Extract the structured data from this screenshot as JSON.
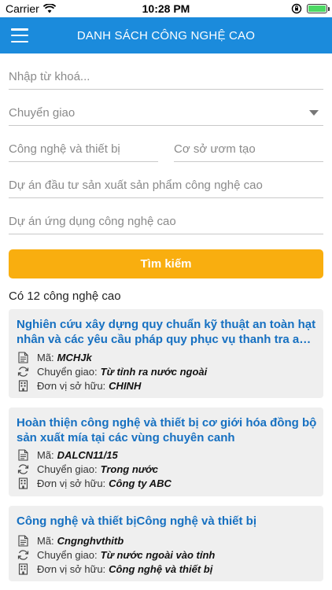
{
  "status_bar": {
    "carrier": "Carrier",
    "time": "10:28 PM"
  },
  "header": {
    "title": "DANH SÁCH CÔNG NGHỆ CAO"
  },
  "form": {
    "keyword_placeholder": "Nhập từ khoá...",
    "transfer_dropdown": "Chuyển giao",
    "tech_equipment_placeholder": "Công nghệ và thiết bị",
    "incubator_placeholder": "Cơ sở ươm tạo",
    "investment_project_placeholder": "Dự án đầu tư sản xuất sản phẩm công nghệ cao",
    "application_project_placeholder": "Dự án ứng dụng công nghệ cao",
    "search_label": "Tìm kiếm"
  },
  "results": {
    "count_text": "Có 12 công nghệ cao",
    "code_label": "Mã:",
    "transfer_label": "Chuyển giao:",
    "owner_label": "Đơn vị sở hữu:",
    "items": [
      {
        "title": "Nghiên cứu xây dựng quy chuẩn kỹ thuật an toàn hạt nhân và các yêu cầu pháp quy phục vụ thanh tra an toàn",
        "code": "MCHJk",
        "transfer": "Từ tỉnh ra nước ngoài",
        "owner": "CHINH"
      },
      {
        "title": "Hoàn thiện công nghệ và thiết bị cơ giới hóa đồng bộ sản xuất mía tại các vùng chuyên canh",
        "code": "DALCN11/15",
        "transfer": "Trong nước",
        "owner": "Công ty ABC"
      },
      {
        "title": "Công nghệ và thiết bịCông nghệ và thiết bị",
        "code": "Cngnghvthitb",
        "transfer": "Từ nước ngoài vào tỉnh",
        "owner": "Công nghệ và thiết bị"
      }
    ]
  }
}
